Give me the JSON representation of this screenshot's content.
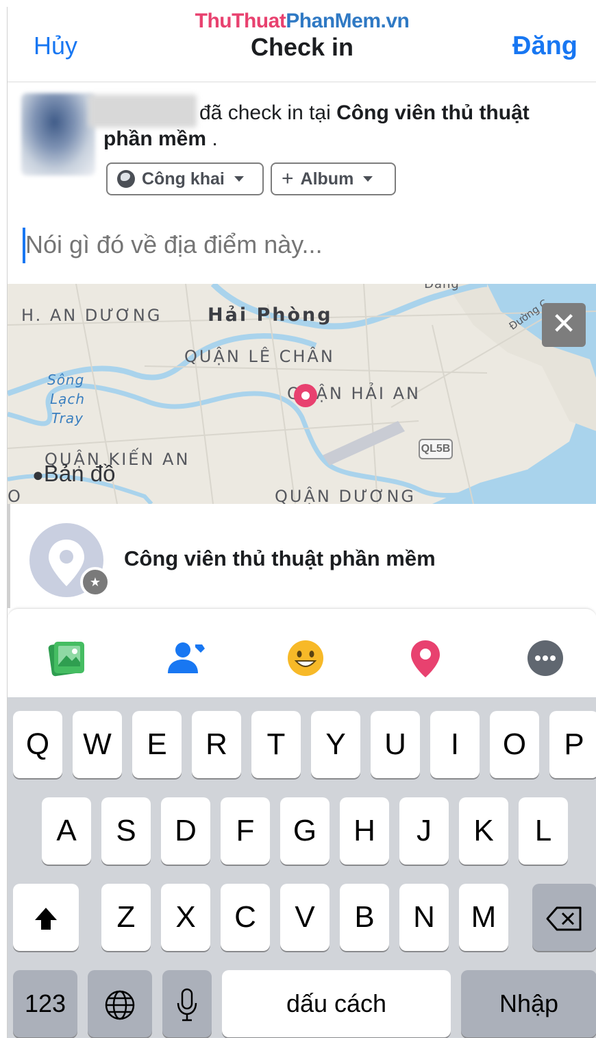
{
  "header": {
    "watermark_a": "ThuThuat",
    "watermark_b": "PhanMem.vn",
    "cancel_label": "Hủy",
    "title": "Check in",
    "post_label": "Đăng"
  },
  "composer": {
    "status_prefix": "đã check in tại ",
    "place_name": "Công viên thủ thuật phần mềm",
    "status_suffix": " .",
    "privacy_label": "Công khai",
    "album_label": "Album",
    "caption_placeholder": "Nói gì đó về địa điểm này..."
  },
  "map": {
    "labels": {
      "an_duong": "H. AN DƯƠNG",
      "hai_phong": "Hải Phòng",
      "le_chan": "QUẬN LÊ CHÂN",
      "hai_an": "QUẬN HẢI AN",
      "kien_an": "QUẬN KIẾN AN",
      "duong": "QUẬN DƯƠNG",
      "song_1": "Sông",
      "song_2": "Lạch",
      "song_3": "Tray",
      "road_top": "Đường C",
      "dang": "Đang",
      "edge": "O"
    },
    "road_badge": "QL5B",
    "attribution": "Bản đồ",
    "close_icon": "close-icon"
  },
  "place": {
    "name": "Công viên thủ thuật phần mềm"
  },
  "actions": {
    "icons": [
      "photo-icon",
      "tag-people-icon",
      "feeling-icon",
      "check-in-icon",
      "more-icon"
    ],
    "colors": {
      "photo": "#45bd62",
      "tag": "#1877f2",
      "feeling": "#f7b928",
      "checkin": "#e8416f",
      "more": "#606770"
    }
  },
  "keyboard": {
    "row1": [
      "Q",
      "W",
      "E",
      "R",
      "T",
      "Y",
      "U",
      "I",
      "O",
      "P"
    ],
    "row2": [
      "A",
      "S",
      "D",
      "F",
      "G",
      "H",
      "J",
      "K",
      "L"
    ],
    "row3": [
      "Z",
      "X",
      "C",
      "V",
      "B",
      "N",
      "M"
    ],
    "numbers_label": "123",
    "space_label": "dấu cách",
    "return_label": "Nhập"
  },
  "colors": {
    "accent": "#1877f2",
    "pin": "#e8416f"
  }
}
